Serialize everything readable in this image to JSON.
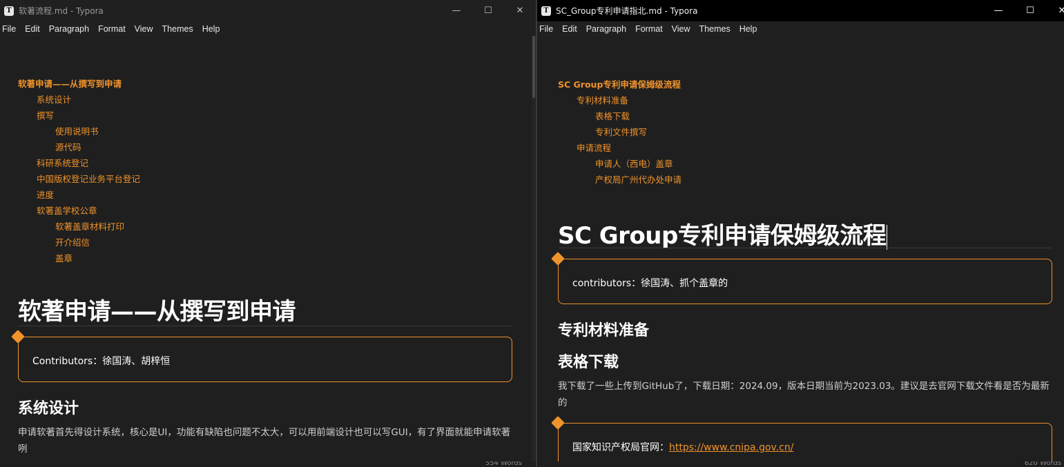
{
  "left": {
    "title": "软著流程.md - Typora",
    "menu": [
      "File",
      "Edit",
      "Paragraph",
      "Format",
      "View",
      "Themes",
      "Help"
    ],
    "toc": {
      "title": "软著申请——从撰写到申请",
      "items": [
        {
          "label": "系统设计",
          "level": 2
        },
        {
          "label": "撰写",
          "level": 2
        },
        {
          "label": "使用说明书",
          "level": 3
        },
        {
          "label": "源代码",
          "level": 3
        },
        {
          "label": "科研系统登记",
          "level": 2
        },
        {
          "label": "中国版权登记业务平台登记",
          "level": 2
        },
        {
          "label": "进度",
          "level": 2
        },
        {
          "label": "软著盖学校公章",
          "level": 2
        },
        {
          "label": "软著盖章材料打印",
          "level": 3
        },
        {
          "label": "开介绍信",
          "level": 3
        },
        {
          "label": "盖章",
          "level": 3
        }
      ]
    },
    "h1": "软著申请——从撰写到申请",
    "callout": "Contributors：徐国涛、胡梓恒",
    "h2": "系统设计",
    "para": "申请软著首先得设计系统，核心是UI，功能有缺陷也问题不太大，可以用前端设计也可以写GUI，有了界面就能申请软著咧",
    "word_count": "554 Words"
  },
  "right": {
    "title": "SC_Group专利申请指北.md - Typora",
    "menu": [
      "File",
      "Edit",
      "Paragraph",
      "Format",
      "View",
      "Themes",
      "Help"
    ],
    "toc": {
      "title": "SC Group专利申请保姆级流程",
      "items": [
        {
          "label": "专利材料准备",
          "level": 2
        },
        {
          "label": "表格下载",
          "level": 3
        },
        {
          "label": "专利文件撰写",
          "level": 3
        },
        {
          "label": "申请流程",
          "level": 2
        },
        {
          "label": "申请人（西电）盖章",
          "level": 3
        },
        {
          "label": "产权局广州代办处申请",
          "level": 3
        }
      ]
    },
    "h1": "SC Group专利申请保姆级流程",
    "callout": "contributors：徐国涛、抓个盖章的",
    "h2a": "专利材料准备",
    "h2b": "表格下载",
    "para": "我下载了一些上传到GitHub了，下载日期：2024.09，版本日期当前为2023.03。建议是去官网下载文件看是否为最新的",
    "callout2_label": "国家知识产权局官网：",
    "callout2_link": "https://www.cnipa.gov.cn/",
    "word_count": "620 Words"
  },
  "colors": {
    "accent": "#f0932b",
    "background": "#1f1f1f",
    "heading": "#ffffff"
  },
  "window_controls": {
    "minimize": "minimize-icon",
    "maximize": "maximize-icon",
    "close": "close-icon"
  }
}
